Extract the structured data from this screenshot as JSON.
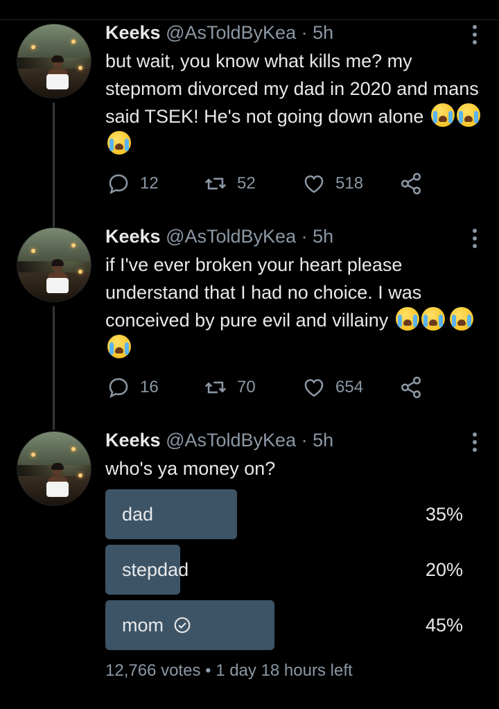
{
  "tweets": [
    {
      "name": "Keeks",
      "handle": "@AsToldByKea",
      "time": "5h",
      "text": "but wait, you know what kills me? my stepmom divorced my dad in 2020 and mans said TSEK! He's not going down alone",
      "emoji": [
        "loudly-crying-face",
        "loudly-crying-face",
        "loudly-crying-face"
      ],
      "replies": "12",
      "retweets": "52",
      "likes": "518"
    },
    {
      "name": "Keeks",
      "handle": "@AsToldByKea",
      "time": "5h",
      "text": "if I've ever broken your heart please understand that I had no choice. I was conceived by pure evil and villainy",
      "emoji": [
        "loudly-crying-face",
        "loudly-crying-face",
        "loudly-crying-face",
        "loudly-crying-face"
      ],
      "replies": "16",
      "retweets": "70",
      "likes": "654"
    },
    {
      "name": "Keeks",
      "handle": "@AsToldByKea",
      "time": "5h",
      "text": "who's ya money on?"
    }
  ],
  "poll": {
    "options": [
      {
        "label": "dad",
        "percent": "35%",
        "fraction": 0.35,
        "selected": false
      },
      {
        "label": "stepdad",
        "percent": "20%",
        "fraction": 0.2,
        "selected": false
      },
      {
        "label": "mom",
        "percent": "45%",
        "fraction": 0.45,
        "selected": true
      }
    ],
    "votes": "12,766 votes",
    "time_left": "1 day 18 hours left"
  },
  "colors": {
    "background": "#000000",
    "text": "#e7e9ea",
    "secondary": "#8b98a5",
    "poll_bar": "#3d5466",
    "thread_line": "#333639"
  },
  "icons": {
    "reply": "reply-icon",
    "retweet": "retweet-icon",
    "like": "heart-icon",
    "share": "share-icon",
    "more": "more-vertical-icon",
    "selected": "check-circle-icon"
  }
}
